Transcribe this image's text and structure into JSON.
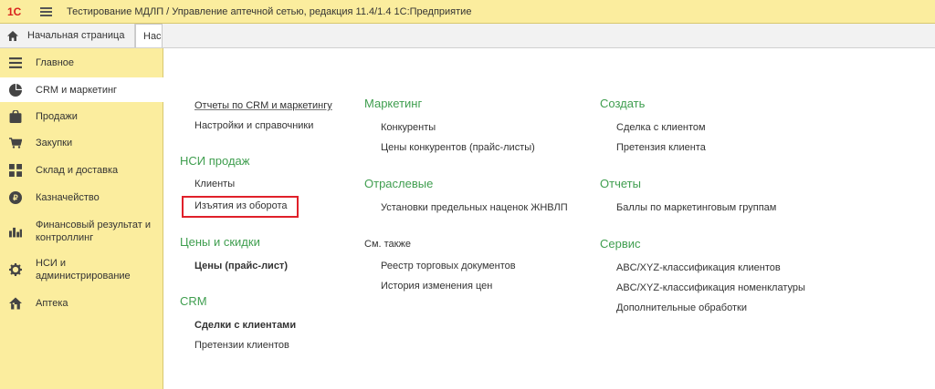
{
  "window": {
    "title": "Тестирование МДЛП / Управление аптечной сетью, редакция 11.4/1.4 1С:Предприятие",
    "logo_text": "1С"
  },
  "tabs": {
    "home_label": "Начальная страница",
    "active_label": "Нас"
  },
  "sidebar": {
    "items": [
      {
        "label": "Главное",
        "icon": "list-icon"
      },
      {
        "label": "CRM и маркетинг",
        "icon": "pie-chart-icon"
      },
      {
        "label": "Продажи",
        "icon": "bag-icon"
      },
      {
        "label": "Закупки",
        "icon": "cart-icon"
      },
      {
        "label": "Склад и доставка",
        "icon": "grid-icon"
      },
      {
        "label": "Казначейство",
        "icon": "coin-icon"
      },
      {
        "label": "Финансовый результат и контроллинг",
        "icon": "bar-chart-icon"
      },
      {
        "label": "НСИ и администрирование",
        "icon": "gear-icon"
      },
      {
        "label": "Аптека",
        "icon": "house-icon"
      }
    ]
  },
  "panel": {
    "col1": {
      "top_links": [
        "Отчеты по CRM и маркетингу",
        "Настройки и справочники"
      ],
      "groups": [
        {
          "title": "НСИ продаж",
          "items": [
            "Клиенты",
            "Изъятия из оборота"
          ]
        },
        {
          "title": "Цены и скидки",
          "items": [
            "Цены (прайс-лист)"
          ]
        },
        {
          "title": "CRM",
          "items": [
            "Сделки с клиентами",
            "Претензии клиентов"
          ]
        }
      ]
    },
    "col2": {
      "groups": [
        {
          "title": "Маркетинг",
          "items": [
            "Конкуренты",
            "Цены конкурентов (прайс-листы)"
          ]
        },
        {
          "title": "Отраслевые",
          "items": [
            "Установки предельных наценок ЖНВЛП"
          ]
        }
      ],
      "see_also": {
        "title": "См. также",
        "items": [
          "Реестр торговых документов",
          "История изменения цен"
        ]
      }
    },
    "col3": {
      "groups": [
        {
          "title": "Создать",
          "items": [
            "Сделка с клиентом",
            "Претензия клиента"
          ]
        },
        {
          "title": "Отчеты",
          "items": [
            "Баллы по маркетинговым группам"
          ]
        },
        {
          "title": "Сервис",
          "items": [
            "ABC/XYZ-классификация клиентов",
            "ABC/XYZ-классификация номенклатуры",
            "Дополнительные обработки"
          ]
        }
      ]
    }
  },
  "colors": {
    "accent_green": "#3f9e4f",
    "sidebar_bg": "#fbed9e",
    "highlight_red": "#e0202a"
  }
}
